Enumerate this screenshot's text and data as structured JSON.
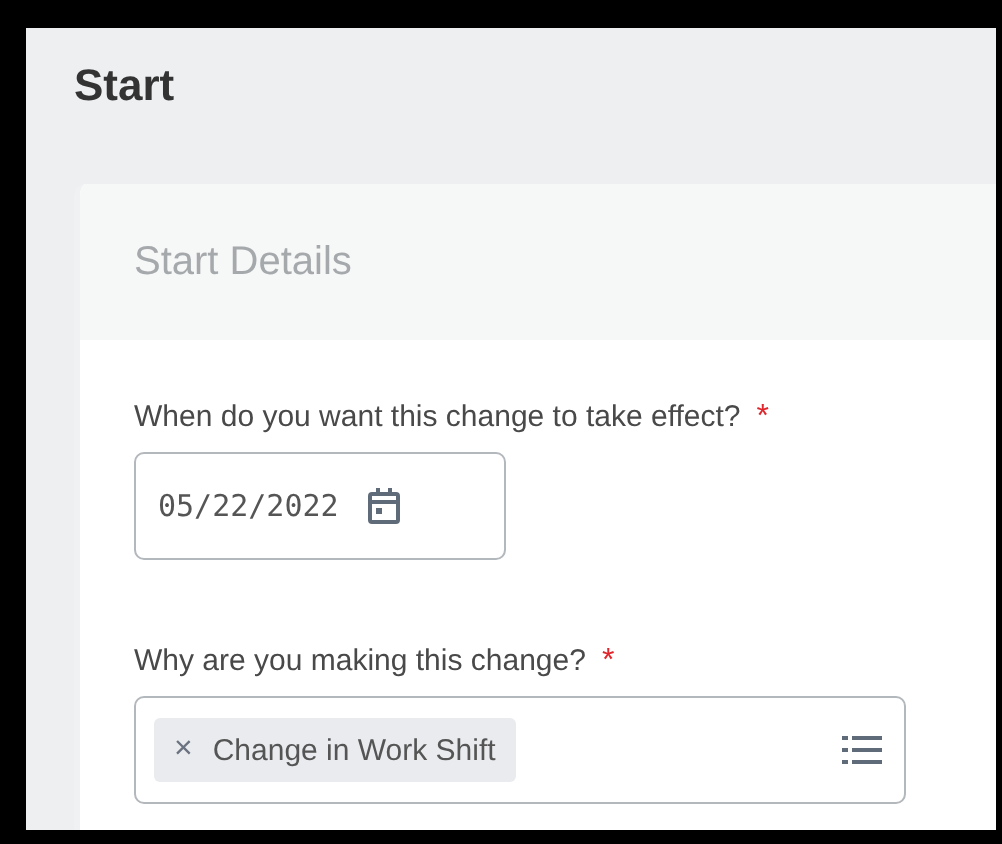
{
  "page_title": "Start",
  "section": {
    "title": "Start Details",
    "fields": [
      {
        "kind": "date",
        "label": "When do you want this change to take effect?",
        "required": true,
        "required_mark": "*",
        "value": "05/22/2022"
      },
      {
        "kind": "multiselect",
        "label": "Why are you making this change?",
        "required": true,
        "required_mark": "*",
        "chips": [
          {
            "remove": "×",
            "label": "Change in Work Shift"
          }
        ]
      }
    ]
  }
}
